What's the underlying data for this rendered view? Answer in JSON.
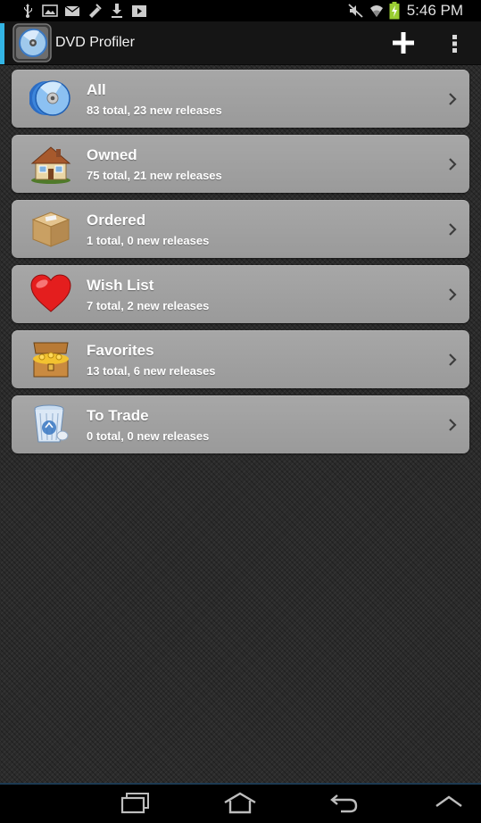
{
  "status_bar": {
    "time": "5:46 PM",
    "left_icons": [
      "usb-icon",
      "image-icon",
      "mail-icon",
      "usb-debug-icon",
      "download-icon",
      "video-icon"
    ],
    "right_icons": [
      "mute-icon",
      "wifi-icon",
      "battery-charging-icon"
    ]
  },
  "action_bar": {
    "title": "DVD Profiler",
    "accent_color": "#33b5e5",
    "actions": [
      "add-icon",
      "overflow-menu-icon"
    ]
  },
  "collections": [
    {
      "name": "All",
      "summary": "83 total, 23 new releases",
      "icon": "disc-stack-icon"
    },
    {
      "name": "Owned",
      "summary": "75 total, 21 new releases",
      "icon": "house-icon"
    },
    {
      "name": "Ordered",
      "summary": "1 total, 0 new releases",
      "icon": "box-icon"
    },
    {
      "name": "Wish List",
      "summary": "7 total, 2 new releases",
      "icon": "heart-icon"
    },
    {
      "name": "Favorites",
      "summary": "13 total, 6 new releases",
      "icon": "treasure-chest-icon"
    },
    {
      "name": "To Trade",
      "summary": "0 total, 0 new releases",
      "icon": "recycle-bin-icon"
    }
  ],
  "nav_bar": {
    "buttons": [
      "recent-apps-icon",
      "home-icon",
      "back-icon",
      "menu-up-icon"
    ]
  }
}
